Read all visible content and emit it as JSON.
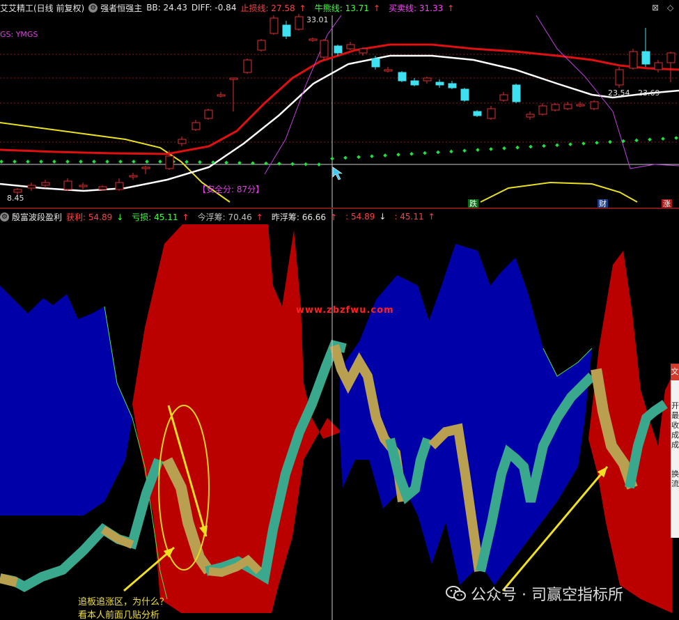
{
  "upper_header": {
    "title": "艾艾精工(日线 前复权)",
    "indicator_name": "强者恒强主",
    "bb": "BB: 24.43",
    "diff": "DIFF: -0.84",
    "stop_loss": "止损线: 27.58",
    "stop_loss_arrow": "↑",
    "bull_line": "牛熊线: 13.71",
    "bull_line_arrow": "↑",
    "trade_line": "买卖线: 31.33",
    "trade_line_arrow": "↑"
  },
  "upper_labels": {
    "ymgs": "GS: YMGS",
    "price_high": "33.01",
    "price_low": "8.45",
    "safety_score": "【安全分: 87分】",
    "price_right_1": "23.54",
    "price_right_2": "23.69"
  },
  "events": [
    "跌",
    "财",
    "涨"
  ],
  "lower_header": {
    "indicator_name": "殷富波段盈利",
    "profit": "获利: 54.89",
    "profit_arrow": "↓",
    "loss": "亏损: 45.11",
    "loss_arrow": "↑",
    "today_float": "今浮筹: 70.46",
    "today_float_arrow": "↑",
    "yesterday_float": "昨浮筹: 66.66",
    "yesterday_float_arrow": "↑",
    "v1": ": 54.89",
    "v1_arrow": "↓",
    "v2": ": 45.11",
    "v2_arrow": "↑"
  },
  "website": "www.zbzfwu.com",
  "annotation": {
    "line1": "追板追涨区，为什么？",
    "line2": "看本人前面几贴分析"
  },
  "watermark": "公众号 · 司赢空指标所",
  "sidebar": {
    "top": "文",
    "lines": [
      "开",
      "最",
      "收",
      "成",
      "成",
      "",
      "换",
      "流"
    ]
  },
  "corner_icons": [
    "close-icon",
    "diamond-icon"
  ],
  "colors": {
    "red_area": "#bb0000",
    "blue_area": "#0000a8",
    "teal_band": "#3aa88c",
    "gold_band": "#b8a050",
    "candle_up": "#e03030",
    "candle_down": "#40e0f0",
    "ma_red": "#e01010",
    "ma_white": "#ffffff",
    "ma_yellow": "#e8e020",
    "ma_magenta": "#c040e0",
    "dots_green": "#20e040"
  }
}
